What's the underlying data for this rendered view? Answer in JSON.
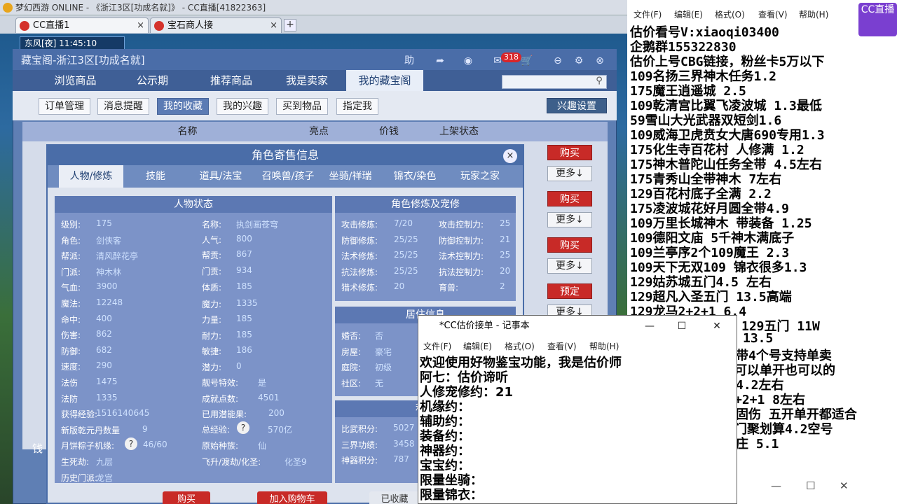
{
  "browser": {
    "title": "梦幻西游 ONLINE - 《浙江3区[功成名就]》 - CC直播[41822363]",
    "tabs": [
      {
        "label": "CC直播1"
      },
      {
        "label": "宝石商人接"
      }
    ],
    "clock": "东风[夜]  11:45:10"
  },
  "cbg": {
    "title": "藏宝阁-浙江3区[功成名就]",
    "help": "助",
    "msg_count": "318",
    "nav": [
      "浏览商品",
      "公示期",
      "推荐商品",
      "我是卖家",
      "我的藏宝阁"
    ],
    "sub": [
      "订单管理",
      "消息提醒",
      "我的收藏",
      "我的兴趣",
      "买到物品",
      "指定我"
    ],
    "interest_btn": "兴趣设置",
    "table_headers": [
      "名称",
      "亮点",
      "价钱",
      "上架状态"
    ],
    "row_buttons": [
      {
        "action": "购买",
        "more": "更多↓"
      },
      {
        "action": "购买",
        "more": "更多↓"
      },
      {
        "action": "购买",
        "more": "更多↓"
      },
      {
        "action": "预定",
        "more": "更多↓"
      }
    ],
    "side_label": "钱"
  },
  "dialog": {
    "title": "角色寄售信息",
    "close": "×",
    "tabs": [
      "人物/修炼",
      "技能",
      "道具/法宝",
      "召唤兽/孩子",
      "坐骑/祥瑞",
      "锦衣/染色",
      "玩家之家"
    ],
    "status_header": "人物状态",
    "left_col": [
      {
        "label": "级别:",
        "value": "175"
      },
      {
        "label": "角色:",
        "value": "剑侠客"
      },
      {
        "label": "帮派:",
        "value": "清风醉花亭"
      },
      {
        "label": "门派:",
        "value": "神木林"
      },
      {
        "label": "气血:",
        "value": "3900"
      },
      {
        "label": "魔法:",
        "value": "12248"
      },
      {
        "label": "命中:",
        "value": "400"
      },
      {
        "label": "伤害:",
        "value": "862"
      },
      {
        "label": "防御:",
        "value": "682"
      },
      {
        "label": "速度:",
        "value": "290"
      },
      {
        "label": "法伤",
        "value": "1475"
      },
      {
        "label": "法防",
        "value": "1335"
      },
      {
        "label": "获得经验:",
        "value": "1516140645"
      },
      {
        "label": "新版乾元丹数量",
        "value": "9"
      },
      {
        "label": "月饼粽子机缘:",
        "value": "46/60"
      },
      {
        "label": "生死劫:",
        "value": "九层"
      },
      {
        "label": "历史门派:",
        "value": "龙宫"
      }
    ],
    "mid_col": [
      {
        "label": "名称:",
        "value": "执剑画苍穹"
      },
      {
        "label": "人气:",
        "value": "800"
      },
      {
        "label": "帮贡:",
        "value": "867"
      },
      {
        "label": "门贡:",
        "value": "934"
      },
      {
        "label": "体质:",
        "value": "185"
      },
      {
        "label": "魔力:",
        "value": "1335"
      },
      {
        "label": "力量:",
        "value": "185"
      },
      {
        "label": "耐力:",
        "value": "185"
      },
      {
        "label": "敏捷:",
        "value": "186"
      },
      {
        "label": "潜力:",
        "value": "0"
      },
      {
        "label": "靓号特效:",
        "value": "是"
      },
      {
        "label": "成就点数:",
        "value": "4501"
      },
      {
        "label": "已用潜能果:",
        "value": "200"
      },
      {
        "label": "总经验:",
        "value": "570亿"
      },
      {
        "label": "原始种族:",
        "value": "仙"
      },
      {
        "label": "飞升/渡劫/化圣:",
        "value": "化圣9"
      }
    ],
    "cultivation_header": "角色修炼及宠修",
    "cultivation": [
      {
        "a": "攻击修炼:",
        "av": "7/20",
        "b": "攻击控制力:",
        "bv": "25"
      },
      {
        "a": "防御修炼:",
        "av": "25/25",
        "b": "防御控制力:",
        "bv": "21"
      },
      {
        "a": "法术修炼:",
        "av": "25/25",
        "b": "法术控制力:",
        "bv": "25"
      },
      {
        "a": "抗法修炼:",
        "av": "25/25",
        "b": "抗法控制力:",
        "bv": "20"
      },
      {
        "a": "猎术修炼:",
        "av": "20",
        "b": "育兽:",
        "bv": "2"
      }
    ],
    "home_header": "居住信息",
    "home": [
      {
        "label": "婚否:",
        "value": "否"
      },
      {
        "label": "房屋:",
        "value": "豪宅"
      },
      {
        "label": "庭院:",
        "value": "初级"
      },
      {
        "label": "社区:",
        "value": "无"
      }
    ],
    "score_header": "积分",
    "score": [
      {
        "label": "比武积分:",
        "value": "5027"
      },
      {
        "label": "三界功绩:",
        "value": "3458"
      },
      {
        "label": "神器积分:",
        "value": "787"
      }
    ],
    "bottom_buttons": [
      "购买",
      "加入购物车",
      "已收藏"
    ]
  },
  "big_notepad": {
    "menu": [
      "文件(F)",
      "编辑(E)",
      "格式(O)",
      "查看(V)",
      "帮助(H)"
    ],
    "lines": [
      "估价看号V:xiaoqi03400",
      "企鹅群155322830",
      "估价上号CBG链接，粉丝卡5万以下",
      "109名扬三界神木任务1.2",
      "175魔王逍遥城 2.5",
      "109乾清宫比翼飞凌波城 1.3最低",
      "59雪山大光武器双短剑1.6",
      "109威海卫虎贲女大唐690专用1.3",
      "175化生寺百花村 人修满 1.2",
      "175神木普陀山任务全带 4.5左右",
      "175青秀山全带神木  7左右",
      "129百花村底子全满 2.2",
      "175凌波城花好月圆全带4.9",
      "109万里长城神木 带装备  1.25",
      "109德阳文庙 5千神木满底子",
      "109兰亭序2个109魔王 2.3",
      "109天下无双109  锦衣很多1.3",
      "129姑苏城五门4.5 左右",
      "129超凡入圣五门  13.5高端",
      "129龙马2+2+1   6.4"
    ],
    "partial_lines": [
      "129五门 11W",
      "13.5",
      "带4个号支持单卖",
      "可以单开也可以的",
      "4.2左右",
      "+2+1  8左右",
      "固伤 五开单开都适合",
      "门聚划算4.2空号",
      "庄  5.1"
    ],
    "logo": "CC直播"
  },
  "small_notepad": {
    "title": "*CC估价接单 - 记事本",
    "menu": [
      "文件(F)",
      "编辑(E)",
      "格式(O)",
      "查看(V)",
      "帮助(H)"
    ],
    "lines": [
      "欢迎使用好物鉴宝功能，我是估价师",
      "阿七：估价谛听",
      "人修宠修约：21",
      "机缘约：",
      "辅助约：",
      "装备约：",
      "神器约：",
      "宝宝约：",
      "限量坐骑：",
      "限量锦衣："
    ]
  }
}
